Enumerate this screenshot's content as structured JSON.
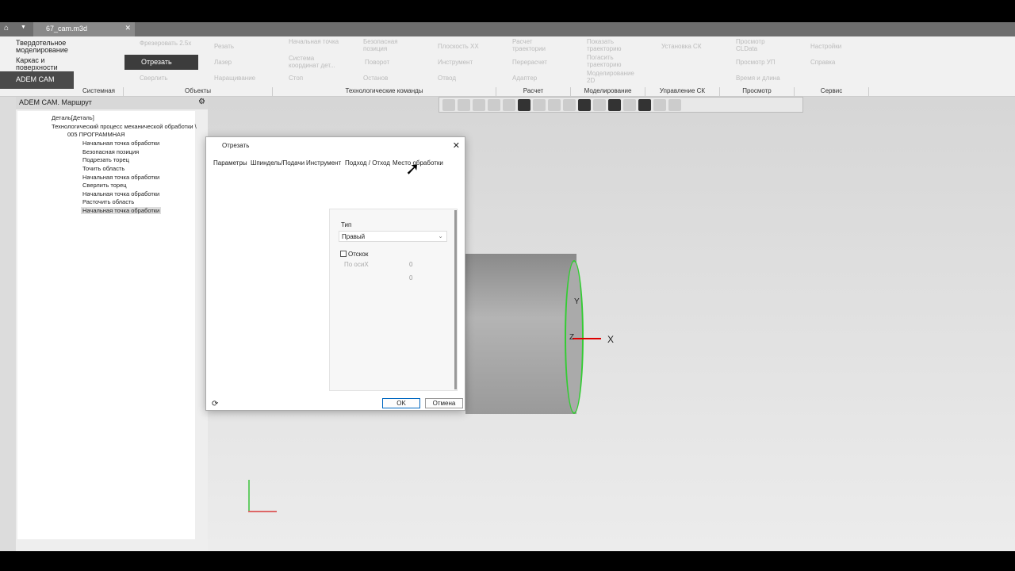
{
  "tab": {
    "title": "67_cam.m3d"
  },
  "modes": [
    "Твердотельное моделирование",
    "Каркас и поверхности",
    "ADEM CAM"
  ],
  "ribbon": {
    "objects": [
      "Фрезеровать 2.5х",
      "Резать",
      "Отрезать",
      "Лазер",
      "Сверлить",
      "Наращивание"
    ],
    "tech": [
      "Начальная точка",
      "Безопасная позиция",
      "Плоскость XX",
      "Система координат дет...",
      "Поворот",
      "Инструмент",
      "Стоп",
      "Останов",
      "Отвод"
    ],
    "calc": [
      "Расчет траектории",
      "Перерасчет",
      "Адаптер"
    ],
    "model": [
      "Показать траекторию",
      "Погасить траекторию",
      "Моделирование 2D"
    ],
    "cs": [
      "Установка СК"
    ],
    "view": [
      "Просмотр CLData",
      "Просмотр УП",
      "Время и длина"
    ],
    "service": [
      "Настройки",
      "Справка"
    ],
    "groups": [
      "Системная",
      "Объекты",
      "Технологические команды",
      "Расчет",
      "Моделирование",
      "Управление СК",
      "Просмотр",
      "Сервис"
    ]
  },
  "panel": {
    "title": "ADEM CAM. Маршрут",
    "tree": [
      "Деталь[Деталь]",
      "Технологический процесс механической обработки \\",
      "005  ПРОГРАММНАЯ",
      "Начальная точка обработки",
      "Безопасная позиция",
      "Подрезать торец",
      "Точить область",
      "Начальная точка обработки",
      "Сверлить торец",
      "Начальная точка обработки",
      "Расточить область",
      "Начальная точка обработки"
    ]
  },
  "dialog": {
    "title": "Отрезать",
    "tabs": [
      "Параметры",
      "Шпиндель/Подачи",
      "Инструмент",
      "Подход / Отход",
      "Место обработки"
    ],
    "type_label": "Тип",
    "type_value": "Правый",
    "rebound_label": "Отскок",
    "axis_label": "По осиX",
    "axis_value": "0",
    "value2": "0",
    "ok": "OK",
    "cancel": "Отмена"
  },
  "axes": {
    "x": "X",
    "y": "Y",
    "z": "Z"
  }
}
